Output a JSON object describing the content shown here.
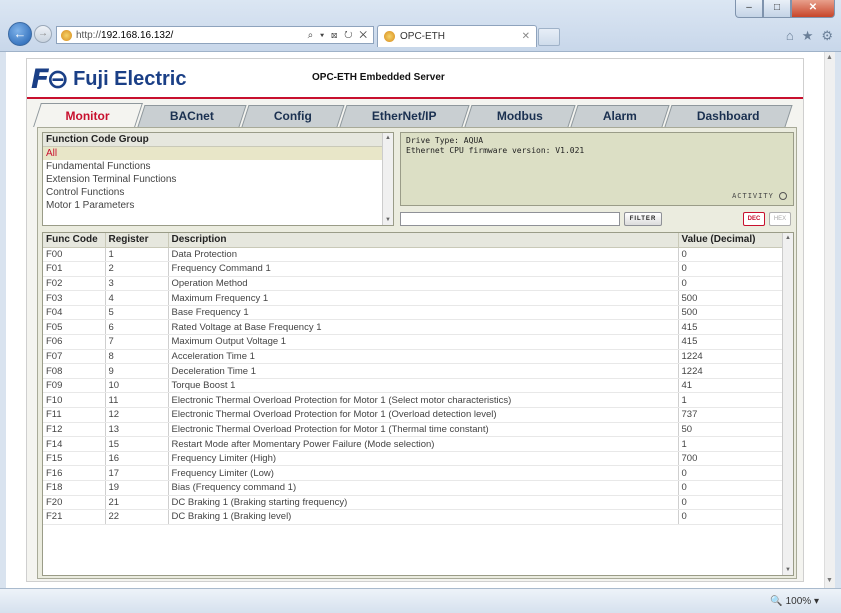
{
  "browser": {
    "url_prefix": "http://",
    "url_host": "192.168.16.132/",
    "address_tools": "⌕ ▾ ⊠ ↻ ✕",
    "tab_title": "OPC-ETH",
    "zoom": "100%"
  },
  "header": {
    "brand": "Fuji Electric",
    "product": "OPC-ETH Embedded Server"
  },
  "tabs": [
    "Monitor",
    "BACnet",
    "Config",
    "EtherNet/IP",
    "Modbus",
    "Alarm",
    "Dashboard"
  ],
  "function_groups": {
    "header": "Function Code Group",
    "items": [
      "All",
      "Fundamental Functions",
      "Extension Terminal Functions",
      "Control Functions",
      "Motor 1 Parameters"
    ],
    "selected": "All"
  },
  "info": {
    "drive_type": "Drive Type: AQUA",
    "firmware": "Ethernet CPU firmware version: V1.021",
    "activity": "ACTIVITY"
  },
  "controls": {
    "filter_value": "",
    "filter_label": "FILTER",
    "dec_label": "DEC",
    "hex_label": "HEX"
  },
  "table": {
    "columns": [
      "Func Code",
      "Register",
      "Description",
      "Value (Decimal)"
    ],
    "rows": [
      [
        "F00",
        "1",
        "Data Protection",
        "0"
      ],
      [
        "F01",
        "2",
        "Frequency Command 1",
        "0"
      ],
      [
        "F02",
        "3",
        "Operation Method",
        "0"
      ],
      [
        "F03",
        "4",
        "Maximum Frequency 1",
        "500"
      ],
      [
        "F04",
        "5",
        "Base Frequency 1",
        "500"
      ],
      [
        "F05",
        "6",
        "Rated Voltage at Base Frequency 1",
        "415"
      ],
      [
        "F06",
        "7",
        "Maximum Output Voltage 1",
        "415"
      ],
      [
        "F07",
        "8",
        "Acceleration Time 1",
        "1224"
      ],
      [
        "F08",
        "9",
        "Deceleration Time 1",
        "1224"
      ],
      [
        "F09",
        "10",
        "Torque Boost 1",
        "41"
      ],
      [
        "F10",
        "11",
        "Electronic Thermal Overload Protection for Motor 1 (Select motor characteristics)",
        "1"
      ],
      [
        "F11",
        "12",
        "Electronic Thermal Overload Protection for Motor 1 (Overload detection level)",
        "737"
      ],
      [
        "F12",
        "13",
        "Electronic Thermal Overload Protection for Motor 1 (Thermal time constant)",
        "50"
      ],
      [
        "F14",
        "15",
        "Restart Mode after Momentary Power Failure (Mode selection)",
        "1"
      ],
      [
        "F15",
        "16",
        "Frequency Limiter (High)",
        "700"
      ],
      [
        "F16",
        "17",
        "Frequency Limiter (Low)",
        "0"
      ],
      [
        "F18",
        "19",
        "Bias (Frequency command 1)",
        "0"
      ],
      [
        "F20",
        "21",
        "DC Braking 1 (Braking starting frequency)",
        "0"
      ],
      [
        "F21",
        "22",
        "DC Braking 1 (Braking level)",
        "0"
      ]
    ]
  }
}
